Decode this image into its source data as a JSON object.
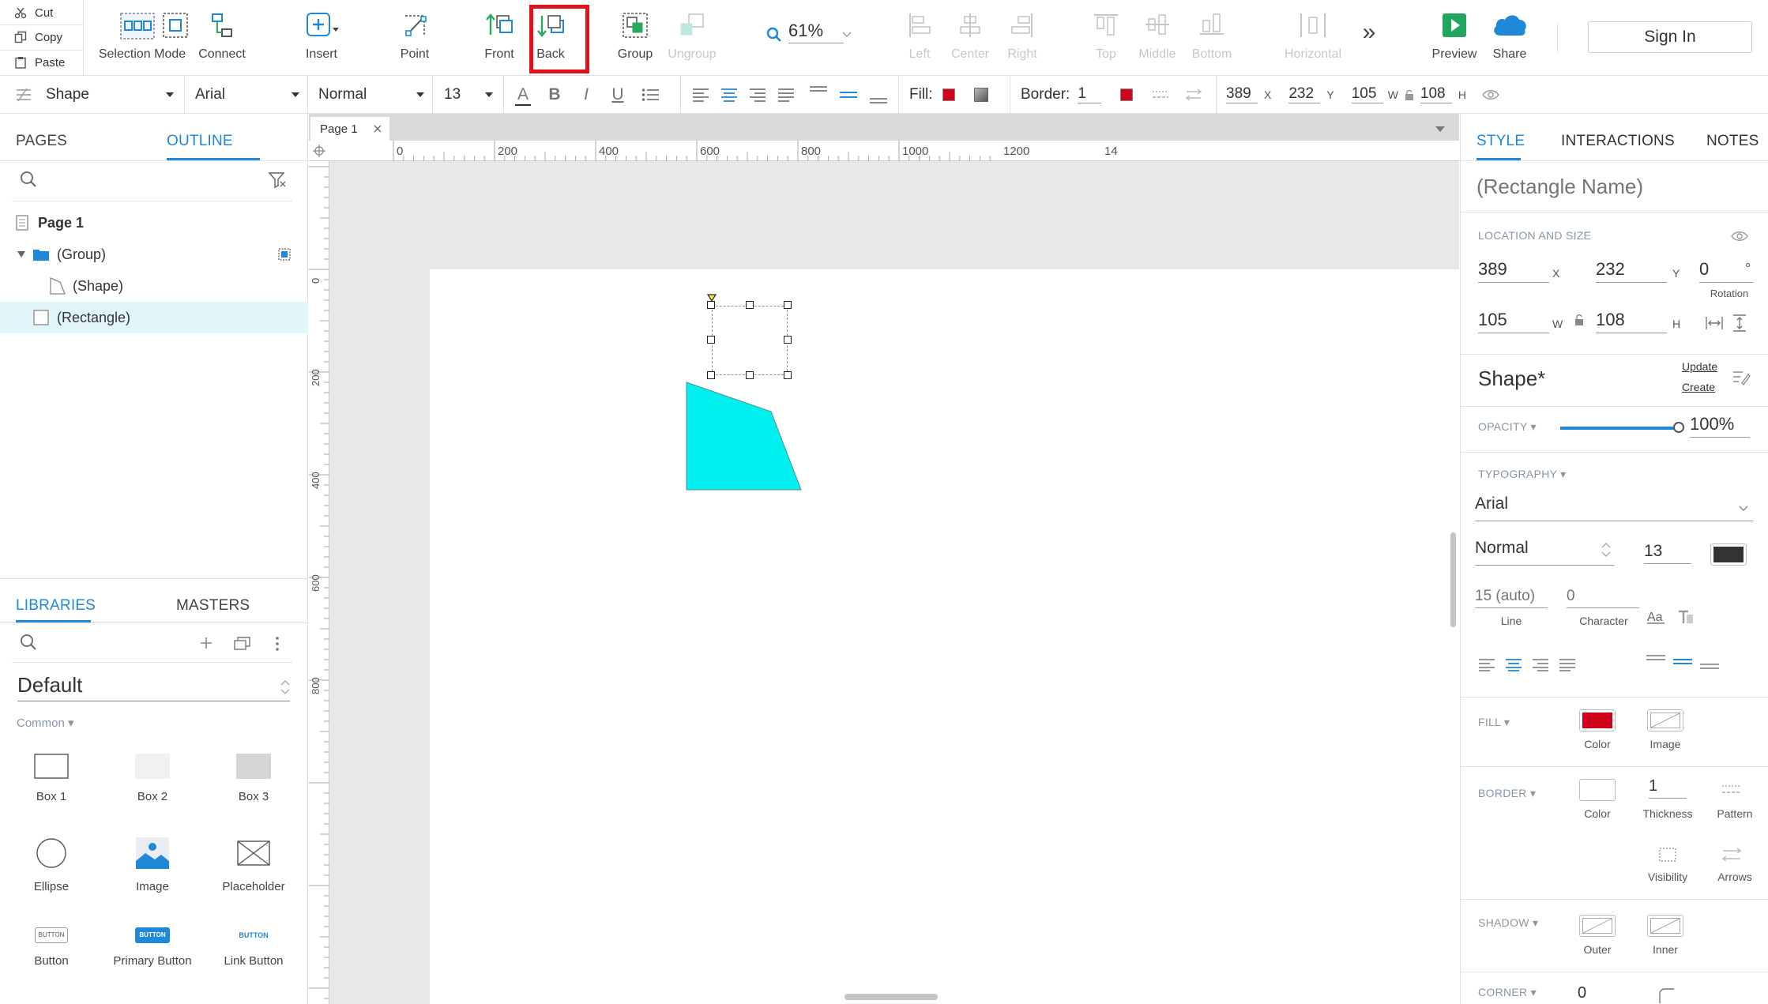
{
  "toolbar": {
    "clipboard": [
      {
        "label": "Cut",
        "icon": "scissors-icon"
      },
      {
        "label": "Copy",
        "icon": "copy-icon"
      },
      {
        "label": "Paste",
        "icon": "paste-icon"
      }
    ],
    "selection_mode": "Selection Mode",
    "connect": "Connect",
    "insert": "Insert",
    "point": "Point",
    "front": "Front",
    "back": "Back",
    "group": "Group",
    "ungroup": "Ungroup",
    "zoom": "61%",
    "left": "Left",
    "center": "Center",
    "right": "Right",
    "top": "Top",
    "middle": "Middle",
    "bottom": "Bottom",
    "horizontal": "Horizontal",
    "more": "»",
    "preview": "Preview",
    "share": "Share",
    "sign_in": "Sign In",
    "highlight_color": "#e0121c"
  },
  "format_bar": {
    "style": "Shape",
    "font": "Arial",
    "weight": "Normal",
    "size": "13",
    "fill_label": "Fill:",
    "fill_color": "#d0021b",
    "border_label": "Border:",
    "border_value": "1",
    "border_color": "#d0021b",
    "x": "389",
    "x_label": "X",
    "y": "232",
    "y_label": "Y",
    "w": "105",
    "w_label": "W",
    "h": "108",
    "h_label": "H"
  },
  "left_panel": {
    "tabs": {
      "pages": "PAGES",
      "outline": "OUTLINE"
    },
    "tree": [
      {
        "label": "Page 1"
      },
      {
        "label": "(Group)"
      },
      {
        "label": "(Shape)"
      },
      {
        "label": "(Rectangle)"
      }
    ],
    "lib_tabs": {
      "libraries": "LIBRARIES",
      "masters": "MASTERS"
    },
    "library_name": "Default",
    "category": "Common ▾",
    "items": [
      "Box 1",
      "Box 2",
      "Box 3",
      "Ellipse",
      "Image",
      "Placeholder",
      "Button",
      "Primary Button",
      "Link Button"
    ],
    "button_text": "BUTTON"
  },
  "canvas": {
    "tab": "Page 1",
    "ruler_top": [
      "0",
      "200",
      "400",
      "600",
      "800",
      "1000",
      "1200",
      "14"
    ],
    "ruler_left": [
      "0",
      "200",
      "400",
      "600",
      "800"
    ],
    "shape_color": "#00f0f0"
  },
  "right_panel": {
    "tabs": {
      "style": "STYLE",
      "interactions": "INTERACTIONS",
      "notes": "NOTES"
    },
    "name_placeholder": "(Rectangle Name)",
    "location_title": "LOCATION AND SIZE",
    "x": "389",
    "x_label": "X",
    "y": "232",
    "y_label": "Y",
    "rotation": "0",
    "rotation_unit": "°",
    "rotation_label": "Rotation",
    "w": "105",
    "w_label": "W",
    "h": "108",
    "h_label": "H",
    "style_name": "Shape*",
    "update": "Update",
    "create": "Create",
    "opacity_label": "OPACITY ▾",
    "opacity_value": "100%",
    "opacity_level": 1.0,
    "typography_label": "TYPOGRAPHY ▾",
    "font": "Arial",
    "weight": "Normal",
    "size": "13",
    "text_color": "#333333",
    "line_placeholder": "15 (auto)",
    "line_label": "Line",
    "char_placeholder": "0",
    "char_label": "Character",
    "fill_label": "FILL ▾",
    "fill_color": "#d0021b",
    "color_label": "Color",
    "image_label": "Image",
    "border_label": "BORDER ▾",
    "border_thickness": "1",
    "thickness_label": "Thickness",
    "pattern_label": "Pattern",
    "visibility_label": "Visibility",
    "arrows_label": "Arrows",
    "shadow_label": "SHADOW ▾",
    "outer_label": "Outer",
    "inner_label": "Inner",
    "corner_label": "CORNER ▾",
    "corner_value": "0"
  }
}
